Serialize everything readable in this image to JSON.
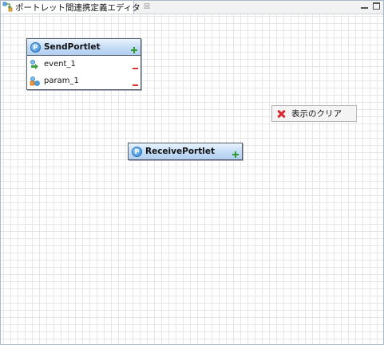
{
  "tab": {
    "title": "ポートレット間連携定義エディタ",
    "close_glyph": "☒"
  },
  "send_portlet": {
    "icon_letter": "P",
    "title": "SendPortlet",
    "rows": [
      {
        "label": "event_1",
        "icon": "event-icon"
      },
      {
        "label": "param_1",
        "icon": "param-icon"
      }
    ]
  },
  "receive_portlet": {
    "icon_letter": "P",
    "title": "ReceivePortlet"
  },
  "clear_button": {
    "label": "表示のクリア",
    "icon": "red-x-icon"
  },
  "colors": {
    "header_blue": "#c6ddf6",
    "add_green": "#2f9a2f",
    "remove_red": "#d33333"
  }
}
